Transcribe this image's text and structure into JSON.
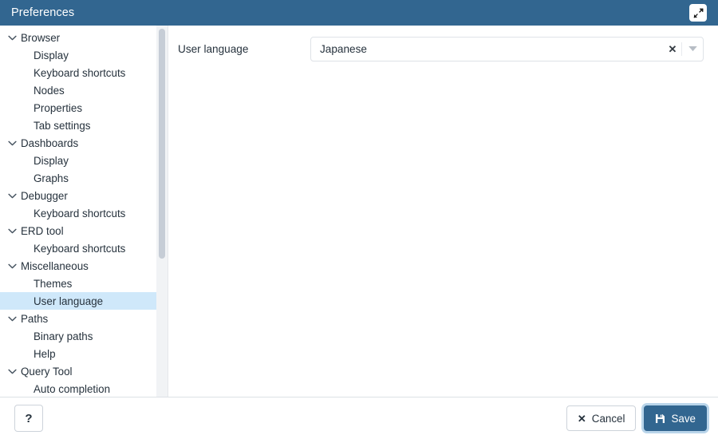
{
  "window": {
    "title": "Preferences",
    "expand_icon": "expand-arrows-icon"
  },
  "sidebar": {
    "items": [
      {
        "label": "Browser",
        "type": "group",
        "expanded": true,
        "selected": false
      },
      {
        "label": "Display",
        "type": "leaf",
        "expanded": false,
        "selected": false
      },
      {
        "label": "Keyboard shortcuts",
        "type": "leaf",
        "expanded": false,
        "selected": false
      },
      {
        "label": "Nodes",
        "type": "leaf",
        "expanded": false,
        "selected": false
      },
      {
        "label": "Properties",
        "type": "leaf",
        "expanded": false,
        "selected": false
      },
      {
        "label": "Tab settings",
        "type": "leaf",
        "expanded": false,
        "selected": false
      },
      {
        "label": "Dashboards",
        "type": "group",
        "expanded": true,
        "selected": false
      },
      {
        "label": "Display",
        "type": "leaf",
        "expanded": false,
        "selected": false
      },
      {
        "label": "Graphs",
        "type": "leaf",
        "expanded": false,
        "selected": false
      },
      {
        "label": "Debugger",
        "type": "group",
        "expanded": true,
        "selected": false
      },
      {
        "label": "Keyboard shortcuts",
        "type": "leaf",
        "expanded": false,
        "selected": false
      },
      {
        "label": "ERD tool",
        "type": "group",
        "expanded": true,
        "selected": false
      },
      {
        "label": "Keyboard shortcuts",
        "type": "leaf",
        "expanded": false,
        "selected": false
      },
      {
        "label": "Miscellaneous",
        "type": "group",
        "expanded": true,
        "selected": false
      },
      {
        "label": "Themes",
        "type": "leaf",
        "expanded": false,
        "selected": false
      },
      {
        "label": "User language",
        "type": "leaf",
        "expanded": false,
        "selected": true
      },
      {
        "label": "Paths",
        "type": "group",
        "expanded": true,
        "selected": false
      },
      {
        "label": "Binary paths",
        "type": "leaf",
        "expanded": false,
        "selected": false
      },
      {
        "label": "Help",
        "type": "leaf",
        "expanded": false,
        "selected": false
      },
      {
        "label": "Query Tool",
        "type": "group",
        "expanded": true,
        "selected": false
      },
      {
        "label": "Auto completion",
        "type": "leaf",
        "expanded": false,
        "selected": false
      }
    ]
  },
  "main": {
    "field": {
      "label": "User language",
      "value": "Japanese",
      "clear_icon": "close-x-icon",
      "caret_icon": "chevron-down-icon"
    }
  },
  "footer": {
    "help_label": "?",
    "cancel_label": "Cancel",
    "cancel_icon": "close-x-icon",
    "save_label": "Save",
    "save_icon": "floppy-disk-icon"
  },
  "colors": {
    "header_blue": "#326690",
    "selection_blue": "#cfe8fa",
    "primary": "#326690"
  }
}
